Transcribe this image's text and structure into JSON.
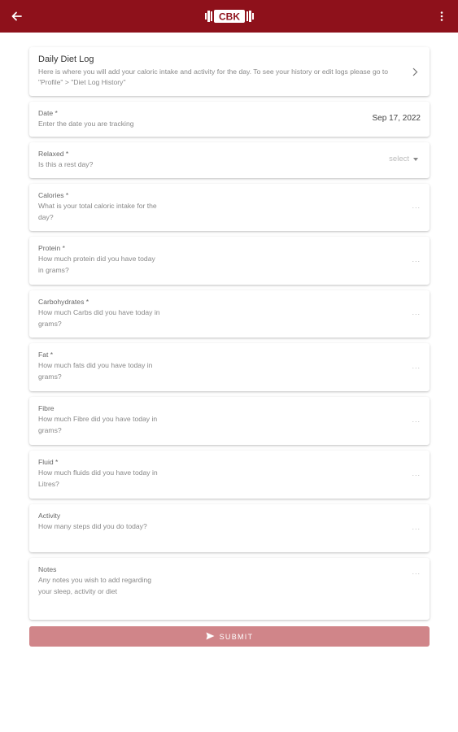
{
  "appbar": {
    "logo_text": "CBK",
    "back_icon": "arrow-left-icon",
    "menu_icon": "more-vertical-icon",
    "color": "#8e111b"
  },
  "intro": {
    "title": "Daily Diet Log",
    "description": "Here is where you will add your caloric intake and activity for the day. To see your history or edit logs please go to \"Profile\" > \"Diet Log History\""
  },
  "fields": [
    {
      "label": "Date *",
      "hint": "Enter the date you are tracking",
      "value": "Sep 17, 2022"
    },
    {
      "label": "Relaxed *",
      "hint": "Is this a rest day?",
      "value": "select"
    },
    {
      "label": "Calories *",
      "hint": "What is your total caloric intake for the day?",
      "value": "..."
    },
    {
      "label": "Protein *",
      "hint": "How much protein did you have today in grams?",
      "value": "..."
    },
    {
      "label": "Carbohydrates *",
      "hint": "How much Carbs did you have today in grams?",
      "value": "..."
    },
    {
      "label": "Fat *",
      "hint": "How much fats did you have today in grams?",
      "value": "..."
    },
    {
      "label": "Fibre",
      "hint": "How much Fibre did you have today in grams?",
      "value": "..."
    },
    {
      "label": "Fluid *",
      "hint": "How much fluids did you have today in Litres?",
      "value": "..."
    },
    {
      "label": "Activity",
      "hint": "How many steps did you do today?",
      "value": "..."
    },
    {
      "label": "Notes",
      "hint": "Any notes you wish to add regarding your sleep, activity or diet",
      "value": "..."
    }
  ],
  "submit": {
    "label": "SUBMIT",
    "color": "#d08589"
  }
}
